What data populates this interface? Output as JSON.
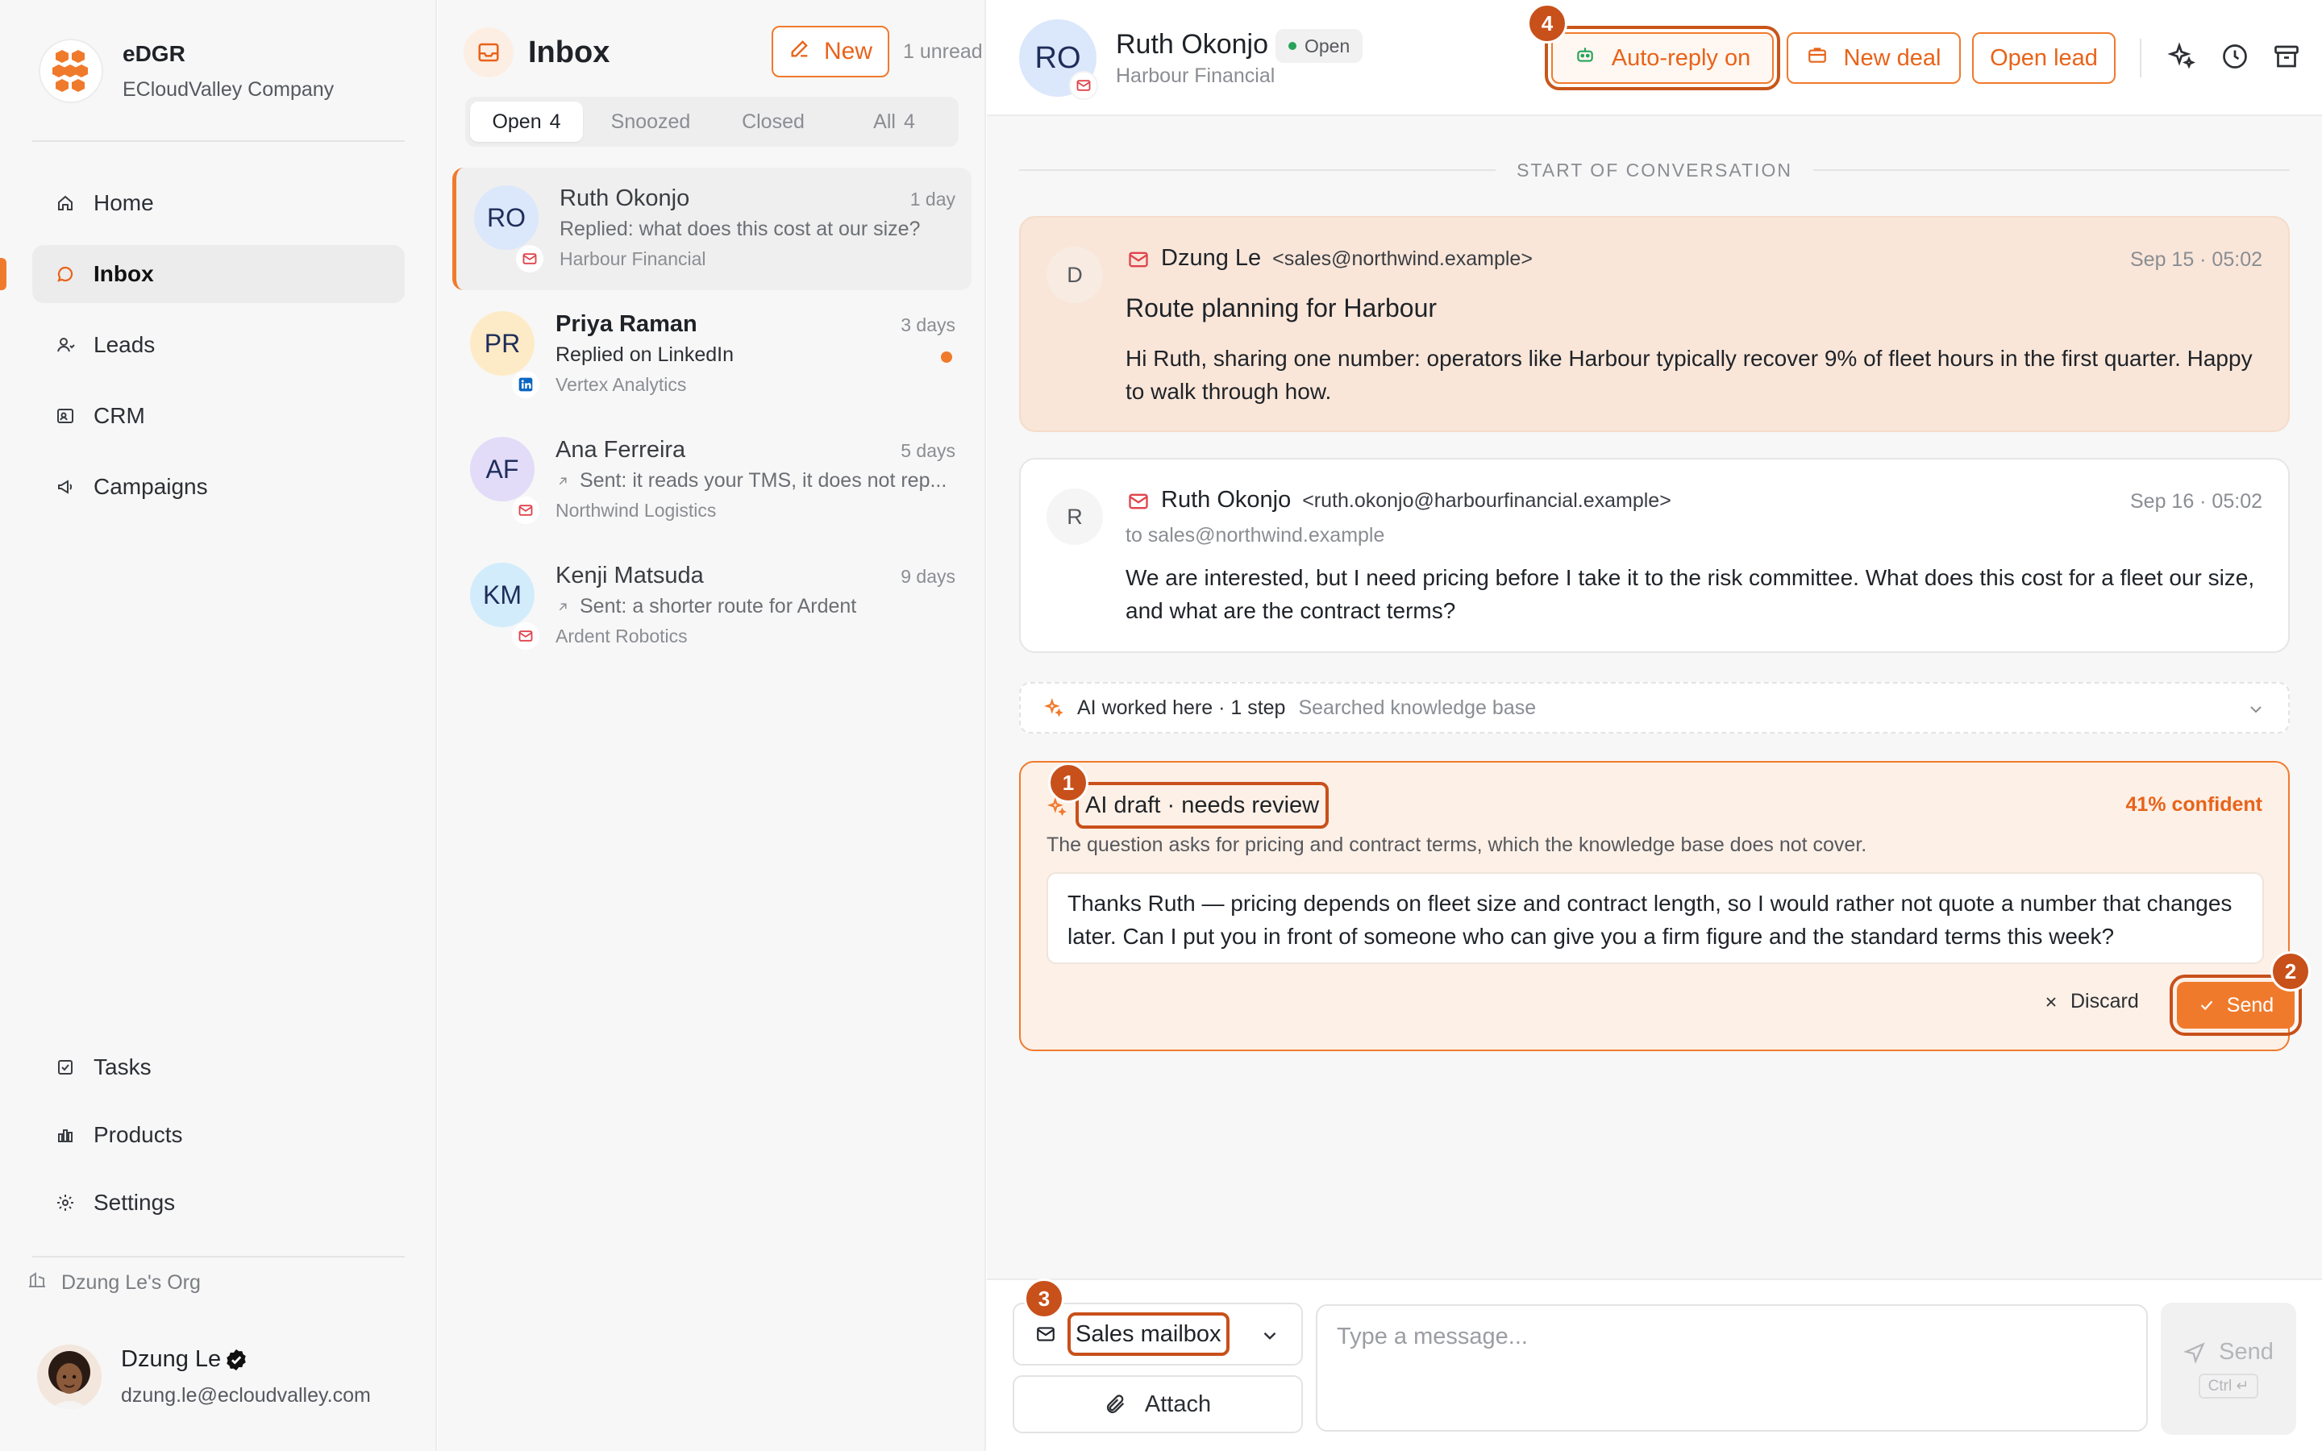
{
  "brand": {
    "name": "eDGR",
    "company": "ECloudValley Company"
  },
  "nav": {
    "items": [
      {
        "label": "Home",
        "icon": "home-icon"
      },
      {
        "label": "Inbox",
        "icon": "chat-bubble-icon",
        "active": true
      },
      {
        "label": "Leads",
        "icon": "person-icon"
      },
      {
        "label": "CRM",
        "icon": "contact-card-icon"
      },
      {
        "label": "Campaigns",
        "icon": "megaphone-icon"
      }
    ],
    "bottom_items": [
      {
        "label": "Tasks",
        "icon": "checkbox-icon"
      },
      {
        "label": "Products",
        "icon": "bar-chart-icon"
      },
      {
        "label": "Settings",
        "icon": "gear-icon"
      }
    ]
  },
  "org": {
    "label": "Dzung Le's Org"
  },
  "user": {
    "name": "Dzung Le",
    "email": "dzung.le@ecloudvalley.com"
  },
  "inbox": {
    "title": "Inbox",
    "new_label": "New",
    "unread_label": "1 unread",
    "tabs": [
      {
        "label": "Open",
        "count": "4",
        "active": true
      },
      {
        "label": "Snoozed",
        "count": ""
      },
      {
        "label": "Closed",
        "count": ""
      },
      {
        "label": "All",
        "count": "4"
      }
    ],
    "conversations": [
      {
        "initials": "RO",
        "name": "Ruth Okonjo",
        "time": "1 day",
        "snippet": "Replied: what does this cost at our size?",
        "company": "Harbour Financial",
        "channel": "email",
        "active": true
      },
      {
        "initials": "PR",
        "name": "Priya Raman",
        "time": "3 days",
        "snippet": "Replied on LinkedIn",
        "company": "Vertex Analytics",
        "channel": "linkedin",
        "unread": true
      },
      {
        "initials": "AF",
        "name": "Ana Ferreira",
        "time": "5 days",
        "snippet": "Sent: it reads your TMS, it does not rep...",
        "company": "Northwind Logistics",
        "channel": "email",
        "sent": true
      },
      {
        "initials": "KM",
        "name": "Kenji Matsuda",
        "time": "9 days",
        "snippet": "Sent: a shorter route for Ardent",
        "company": "Ardent Robotics",
        "channel": "email",
        "sent": true
      }
    ]
  },
  "thread": {
    "contact": {
      "initials": "RO",
      "name": "Ruth Okonjo",
      "status": "Open",
      "company": "Harbour Financial"
    },
    "actions": {
      "auto_reply": "Auto-reply on",
      "new_deal": "New deal",
      "open_lead": "Open lead"
    },
    "start_label": "START OF CONVERSATION",
    "messages": [
      {
        "avatar": "D",
        "from": "Dzung Le",
        "address": "<sales@northwind.example>",
        "date": "Sep 15 · 05:02",
        "subject": "Route planning for Harbour",
        "body": "Hi Ruth, sharing one number: operators like Harbour typically recover 9% of fleet hours in the first quarter. Happy to walk through how."
      },
      {
        "avatar": "R",
        "from": "Ruth Okonjo",
        "address": "<ruth.okonjo@harbourfinancial.example>",
        "to": "to sales@northwind.example",
        "date": "Sep 16 · 05:02",
        "body": "We are interested, but I need pricing before I take it to the risk committee. What does this cost for a fleet our size, and what are the contract terms?"
      }
    ],
    "ai_worked": {
      "title": "AI worked here · 1 step",
      "detail": "Searched knowledge base"
    },
    "draft": {
      "title": "AI draft · needs review",
      "confidence": "41% confident",
      "reason": "The question asks for pricing and contract terms, which the knowledge base does not cover.",
      "text": "Thanks Ruth — pricing depends on fleet size and contract length, so I would rather not quote a number that changes later. Can I put you in front of someone who can give you a firm figure and the standard terms this week?",
      "discard_label": "Discard",
      "send_label": "Send"
    }
  },
  "composer": {
    "mailbox": "Sales mailbox",
    "attach_label": "Attach",
    "placeholder": "Type a message...",
    "send_label": "Send",
    "shortcut": "Ctrl ↵"
  },
  "steps": [
    "1",
    "2",
    "3",
    "4"
  ],
  "colors": {
    "accent": "#f07a2c",
    "highlight": "#c8501a",
    "status_open": "#27a35a"
  }
}
